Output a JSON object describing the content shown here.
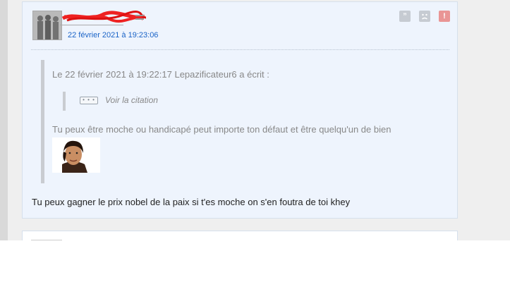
{
  "post": {
    "author_pseudo": "",
    "date": "22 février 2021 à 19:23:06",
    "actions": {
      "quote_icon": "quote-icon",
      "mp_icon": "sad-face-icon",
      "report_icon": "alert-icon"
    },
    "quote": {
      "header": "Le 22 février 2021 à 19:22:17 Lepazificateur6 a écrit :",
      "nested_button": "• • •",
      "nested_label": "Voir la citation",
      "text": "Tu peux être moche ou handicapé peut importe ton défaut et être quelqu'un de bien",
      "sticker": "sticker-image"
    },
    "reply": "Tu peux gagner le prix nobel de la paix si t'es moche on s'en foutra de toi khey"
  },
  "colors": {
    "date_link": "#1a63c7",
    "post_bg": "#eef4fd",
    "alert": "#e99595"
  }
}
